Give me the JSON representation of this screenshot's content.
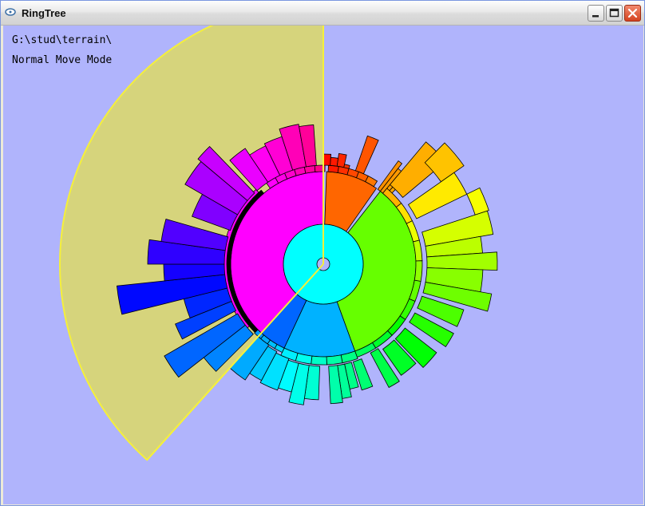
{
  "window": {
    "title": "RingTree"
  },
  "overlay": {
    "path": "G:\\stud\\terrain\\",
    "mode": "Normal Move Mode"
  },
  "colors": {
    "canvas_bg": "#b0b4fc",
    "highlight_fill": "#d6d47c",
    "highlight_stroke": "#f5f03a",
    "root_center": "#b0b4fc",
    "core_ring": "#00ffff"
  },
  "icons": {
    "app": "ringtree-app-icon",
    "minimize": "minimize-icon",
    "maximize": "maximize-icon",
    "close": "close-icon"
  }
}
